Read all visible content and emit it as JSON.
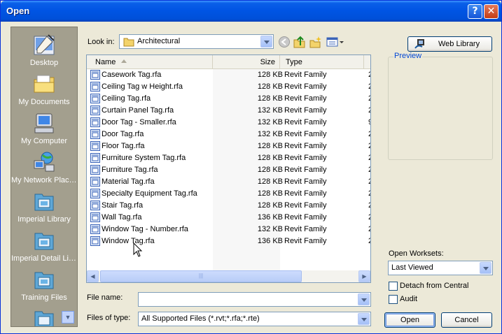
{
  "window": {
    "title": "Open"
  },
  "places": [
    {
      "label": "Desktop",
      "icon": "desktop-icon"
    },
    {
      "label": "My Documents",
      "icon": "my-documents-icon"
    },
    {
      "label": "My Computer",
      "icon": "my-computer-icon"
    },
    {
      "label": "My Network Places",
      "icon": "network-places-icon"
    },
    {
      "label": "Imperial Library",
      "icon": "folder-library-icon"
    },
    {
      "label": "Imperial Detail Libr...",
      "icon": "folder-library-icon"
    },
    {
      "label": "Training Files",
      "icon": "folder-library-icon"
    }
  ],
  "lookin": {
    "label": "Look in:",
    "value": "Architectural"
  },
  "web_library_label": "Web Library",
  "preview_label": "Preview",
  "columns": {
    "name": "Name",
    "size": "Size",
    "type": "Type"
  },
  "files": [
    {
      "name": "Casework Tag.rfa",
      "size": "128 KB",
      "type": "Revit Family",
      "date": "2"
    },
    {
      "name": "Ceiling Tag w Height.rfa",
      "size": "128 KB",
      "type": "Revit Family",
      "date": "2"
    },
    {
      "name": "Ceiling Tag.rfa",
      "size": "128 KB",
      "type": "Revit Family",
      "date": "2"
    },
    {
      "name": "Curtain Panel Tag.rfa",
      "size": "132 KB",
      "type": "Revit Family",
      "date": "2"
    },
    {
      "name": "Door Tag - Smaller.rfa",
      "size": "132 KB",
      "type": "Revit Family",
      "date": "9"
    },
    {
      "name": "Door Tag.rfa",
      "size": "132 KB",
      "type": "Revit Family",
      "date": "2"
    },
    {
      "name": "Floor Tag.rfa",
      "size": "128 KB",
      "type": "Revit Family",
      "date": "2"
    },
    {
      "name": "Furniture System Tag.rfa",
      "size": "128 KB",
      "type": "Revit Family",
      "date": "2"
    },
    {
      "name": "Furniture Tag.rfa",
      "size": "128 KB",
      "type": "Revit Family",
      "date": "2"
    },
    {
      "name": "Material Tag.rfa",
      "size": "128 KB",
      "type": "Revit Family",
      "date": "2"
    },
    {
      "name": "Specialty Equipment Tag.rfa",
      "size": "128 KB",
      "type": "Revit Family",
      "date": "2"
    },
    {
      "name": "Stair Tag.rfa",
      "size": "128 KB",
      "type": "Revit Family",
      "date": "2"
    },
    {
      "name": "Wall Tag.rfa",
      "size": "136 KB",
      "type": "Revit Family",
      "date": "2"
    },
    {
      "name": "Window Tag - Number.rfa",
      "size": "132 KB",
      "type": "Revit Family",
      "date": "2"
    },
    {
      "name": "Window Tag.rfa",
      "size": "136 KB",
      "type": "Revit Family",
      "date": "2"
    }
  ],
  "filename": {
    "label": "File name:",
    "value": ""
  },
  "filetype": {
    "label": "Files of type:",
    "value": "All Supported Files (*.rvt;*.rfa;*.rte)"
  },
  "worksets": {
    "label": "Open Worksets:",
    "value": "Last Viewed"
  },
  "detach_label": "Detach from Central",
  "audit_label": "Audit",
  "open_label": "Open",
  "cancel_label": "Cancel",
  "colors": {
    "title_bar": "#0054e3",
    "dialog_bg": "#ece9d8",
    "places_bg": "#a39f8e",
    "accent_blue": "#0046d5"
  }
}
